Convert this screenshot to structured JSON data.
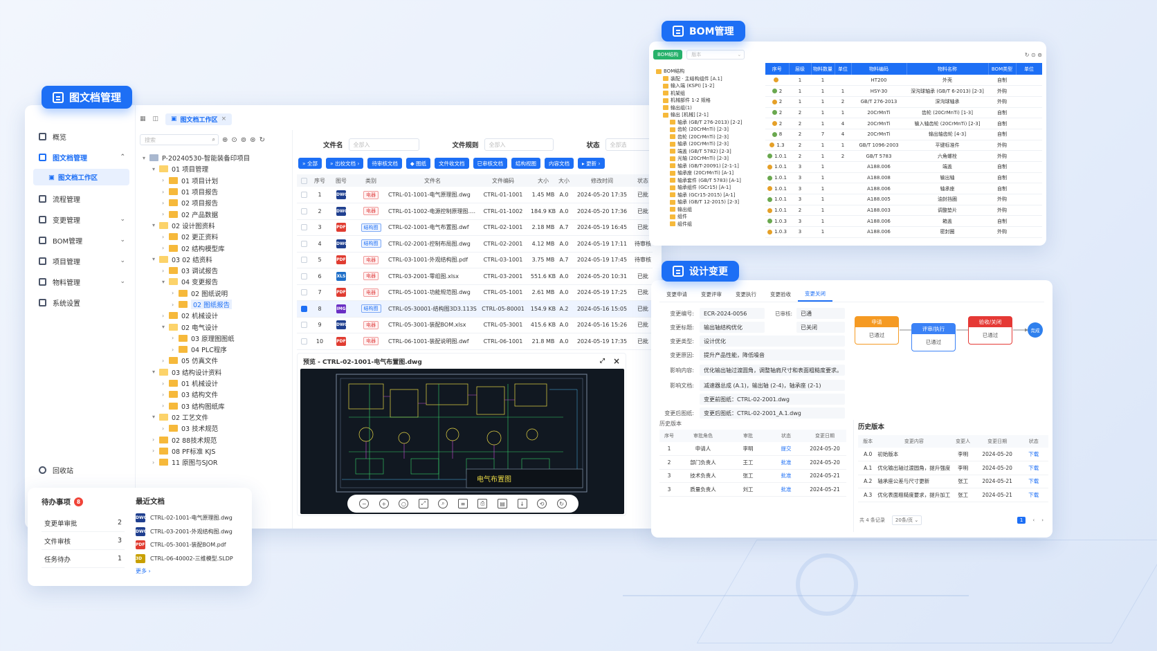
{
  "badges": {
    "doc": "图文档管理",
    "bom": "BOM管理",
    "change": "设计变更"
  },
  "sidebar": {
    "items": [
      {
        "label": "概览",
        "chev": ""
      },
      {
        "label": "图文档管理",
        "chev": "⌃",
        "active": true
      },
      {
        "label": "流程管理",
        "chev": ""
      },
      {
        "label": "变更管理",
        "chev": "⌄"
      },
      {
        "label": "BOM管理",
        "chev": "⌄"
      },
      {
        "label": "项目管理",
        "chev": "⌄"
      },
      {
        "label": "物料管理",
        "chev": "⌄"
      },
      {
        "label": "系统设置",
        "chev": ""
      }
    ],
    "sub": "图文档工作区",
    "recycle": "回收站"
  },
  "tab": {
    "label": "图文档工作区",
    "close": "×"
  },
  "tree": {
    "search_placeholder": "搜索",
    "nodes": [
      {
        "d": 0,
        "c": "▾",
        "t": "P-20240530-智能装备印项目",
        "f": "root"
      },
      {
        "d": 1,
        "c": "▾",
        "t": "01 项目管理",
        "f": "open"
      },
      {
        "d": 2,
        "c": "›",
        "t": "01 项目计划"
      },
      {
        "d": 2,
        "c": "›",
        "t": "01 项目报告"
      },
      {
        "d": 2,
        "c": "›",
        "t": "02 项目报告"
      },
      {
        "d": 2,
        "c": "›",
        "t": "02 产品数据"
      },
      {
        "d": 1,
        "c": "▾",
        "t": "02 设计图资料",
        "f": "open"
      },
      {
        "d": 2,
        "c": "›",
        "t": "02 更正资料"
      },
      {
        "d": 2,
        "c": "›",
        "t": "02 结构模型库"
      },
      {
        "d": 1,
        "c": "▾",
        "t": "03 02 结资料",
        "f": "open"
      },
      {
        "d": 2,
        "c": "›",
        "t": "03 调试报告"
      },
      {
        "d": 2,
        "c": "▾",
        "t": "04 变更报告",
        "f": "open"
      },
      {
        "d": 3,
        "c": "›",
        "t": "02 图纸说明"
      },
      {
        "d": 3,
        "c": "›",
        "t": "02 图纸报告",
        "sel": true
      },
      {
        "d": 2,
        "c": "›",
        "t": "02 机械设计"
      },
      {
        "d": 2,
        "c": "▾",
        "t": "02 电气设计",
        "f": "open"
      },
      {
        "d": 3,
        "c": "›",
        "t": "03 原理图图纸"
      },
      {
        "d": 3,
        "c": "›",
        "t": "04 PLC程序"
      },
      {
        "d": 2,
        "c": "›",
        "t": "05 仿真文件"
      },
      {
        "d": 1,
        "c": "▾",
        "t": "03 结构设计资料",
        "f": "open"
      },
      {
        "d": 2,
        "c": "›",
        "t": "01 机械设计"
      },
      {
        "d": 2,
        "c": "›",
        "t": "03 结构文件"
      },
      {
        "d": 2,
        "c": "›",
        "t": "03 结构图纸库"
      },
      {
        "d": 1,
        "c": "▾",
        "t": "02 工艺文件",
        "f": "open"
      },
      {
        "d": 2,
        "c": "›",
        "t": "03 技术规范"
      },
      {
        "d": 1,
        "c": "›",
        "t": "02 88技术规范"
      },
      {
        "d": 1,
        "c": "›",
        "t": "08 PF标准 KJS"
      },
      {
        "d": 1,
        "c": "›",
        "t": "11 原图与SJOR"
      }
    ]
  },
  "filters": {
    "file_name": "文件名",
    "file_name_ph": "全部入",
    "file_rule": "文件规则",
    "file_rule_ph": "全部入",
    "status": "状态",
    "status_ph": "全部选"
  },
  "toolbar": [
    "» 全部",
    "» 出校文档 ›",
    "待审核文档",
    "◆ 图纸",
    "文件收文档",
    "已审核文档",
    "结构视图",
    "内容文档",
    "▸ 更新 ›"
  ],
  "table": {
    "headers": [
      "",
      "序号",
      "图号",
      "类别",
      "文件名",
      "文件编码",
      "大小",
      "大小",
      "修改时间",
      "状态"
    ],
    "rows": [
      {
        "n": "1",
        "ic": "DWG",
        "icc": "#1f3f8f",
        "cat": "电器",
        "cb": false,
        "name": "CTRL-01-1001-电气原理图.dwg",
        "code": "CTRL-01-1001",
        "size": "1.45 MB",
        "v": "A.0",
        "time": "2024-05-20 17:35",
        "st": "已批"
      },
      {
        "n": "2",
        "ic": "DWG",
        "icc": "#1f3f8f",
        "cat": "电器",
        "cb": false,
        "name": "CTRL-01-1002-电源控制原理图.dwg",
        "code": "CTRL-01-1002",
        "size": "184.9 KB",
        "v": "A.0",
        "time": "2024-05-20 17:36",
        "st": "已批"
      },
      {
        "n": "3",
        "ic": "PDF",
        "icc": "#e03c31",
        "cat": "结构图",
        "cb": true,
        "name": "CTRL-02-1001-电气布置图.dwf",
        "code": "CTRL-02-1001",
        "size": "2.18 MB",
        "v": "A.7",
        "time": "2024-05-19 16:45",
        "st": "已批"
      },
      {
        "n": "4",
        "ic": "DWG",
        "icc": "#1f3f8f",
        "cat": "结构图",
        "cb": true,
        "name": "CTRL-02-2001-控制布局图.dwg",
        "code": "CTRL-02-2001",
        "size": "4.12 MB",
        "v": "A.0",
        "time": "2024-05-19 17:11",
        "st": "待审核"
      },
      {
        "n": "5",
        "ic": "PDF",
        "icc": "#e03c31",
        "cat": "电器",
        "cb": false,
        "name": "CTRL-03-1001-外观结构图.pdf",
        "code": "CTRL-03-1001",
        "size": "3.75 MB",
        "v": "A.7",
        "time": "2024-05-19 17:45",
        "st": "待审核"
      },
      {
        "n": "6",
        "ic": "XLS",
        "icc": "#1f6fc8",
        "cat": "电器",
        "cb": false,
        "name": "CTRL-03-2001-零组图.xlsx",
        "code": "CTRL-03-2001",
        "size": "551.6 KB",
        "v": "A.0",
        "time": "2024-05-20 10:31",
        "st": "已批"
      },
      {
        "n": "7",
        "ic": "PDF",
        "icc": "#e03c31",
        "cat": "电器",
        "cb": false,
        "name": "CTRL-05-1001-功能规范图.dwg",
        "code": "CTRL-05-1001",
        "size": "2.61 MB",
        "v": "A.0",
        "time": "2024-05-19 17:25",
        "st": "已批"
      },
      {
        "n": "8",
        "ic": "IMG",
        "icc": "#6a2fc4",
        "cat": "结构图",
        "cb": true,
        "name": "CTRL-05-30001-结构图3D3.113S",
        "code": "CTRL-05-80001",
        "size": "154.9 KB",
        "v": "A.2",
        "time": "2024-05-16 15:05",
        "st": "已批",
        "hl": true
      },
      {
        "n": "9",
        "ic": "DWG",
        "icc": "#1f3f8f",
        "cat": "电器",
        "cb": false,
        "name": "CTRL-05-3001-装配BOM.xlsx",
        "code": "CTRL-05-3001",
        "size": "415.6 KB",
        "v": "A.0",
        "time": "2024-05-16 15:26",
        "st": "已批"
      },
      {
        "n": "10",
        "ic": "PDF",
        "icc": "#e03c31",
        "cat": "电器",
        "cb": false,
        "name": "CTRL-06-1001-装配说明图.dwf",
        "code": "CTRL-06-1001",
        "size": "21.8 MB",
        "v": "A.0",
        "time": "2024-05-19 17:35",
        "st": "已批"
      }
    ]
  },
  "preview": {
    "title": "预览 - CTRL-02-1001-电气布置图.dwg",
    "drawing_title": "电气布置图"
  },
  "todo": {
    "title": "待办事项",
    "count": "8",
    "items": [
      {
        "label": "变更单审批",
        "n": "2"
      },
      {
        "label": "文件审核",
        "n": "3"
      },
      {
        "label": "任务待办",
        "n": "1"
      }
    ]
  },
  "recent": {
    "title": "最近文档",
    "more": "更多 ›",
    "items": [
      {
        "name": "CTRL-02-1001-电气原理图.dwg",
        "ic": "DWG",
        "c": "#1f3f8f"
      },
      {
        "name": "CTRL-03-2001-外观结构图.dwg",
        "ic": "DWG",
        "c": "#1f3f8f"
      },
      {
        "name": "CTRL-05-3001-装配BOM.pdf",
        "ic": "PDF",
        "c": "#e03c31"
      },
      {
        "name": "CTRL-06-40002-三维模型.SLDP",
        "ic": "3D",
        "c": "#c8a000"
      }
    ]
  },
  "bom": {
    "tab_active": "BOM结构",
    "select_ph": "版本",
    "tree": [
      "BOM结构",
      "装配 · 主结构组件 [A.1]",
      "输入端 (KSPI) [1-2]",
      "机架组",
      "机械部件 1-2 规格",
      "输出组(1)",
      "输出 [机械] [2-1]",
      "轴承 (GB/T 276-2013) [2-2]",
      "齿轮 (20CrMnTi) [2-3]",
      "齿轮 (20CrMnTi) [2-3]",
      "轴承 (20CrMnTi) [2-3]",
      "端盖 (GB/T 5782) [2-3]",
      "光轴 (20CrMnTi) [2-3]",
      "轴承 (GB/T-20091) [2-1-1]",
      "轴承座 (20CrMnTi) [A-1]",
      "轴承套件 (GB/T 5783) [A-1]",
      "轴承组件 (GCr15) [A-1]",
      "轴承 (GCr15-2015) [A-1]",
      "轴承 (GB/T 12-2015) [2-3]",
      "输出组",
      "组件",
      "组件组"
    ],
    "headers": [
      "序号",
      "层级",
      "物料数量",
      "单位",
      "物料编码",
      "物料名称",
      "BOM类型",
      "单位"
    ],
    "rows": [
      [
        "",
        "1",
        "1",
        "",
        "HT200",
        "外壳",
        "自制"
      ],
      [
        "2",
        "1",
        "1",
        "1",
        "HSY-30",
        "深沟球轴承 (GB/T 6-2013) [2-3]",
        "外购"
      ],
      [
        "2",
        "1",
        "1",
        "2",
        "GB/T 276-2013",
        "深沟球轴承",
        "外购"
      ],
      [
        "2",
        "2",
        "1",
        "1",
        "20CrMnTi",
        "齿轮 (20CrMnTi) [1-3]",
        "自制"
      ],
      [
        "2",
        "2",
        "1",
        "4",
        "20CrMnTi",
        "输入轴齿轮 (20CrMnTi) [2-3]",
        "自制"
      ],
      [
        "8",
        "2",
        "7",
        "4",
        "20CrMnTi",
        "输出轴齿轮 [4-3]",
        "自制"
      ],
      [
        "1.3",
        "2",
        "1",
        "1",
        "GB/T 1096-2003",
        "平键标准件",
        "外购"
      ],
      [
        "1.0.1",
        "2",
        "1",
        "2",
        "GB/T 5783",
        "六角螺栓",
        "外购"
      ],
      [
        "1.0.1",
        "3",
        "1",
        "",
        "A188.006",
        "端盖",
        "自制"
      ],
      [
        "1.0.1",
        "3",
        "1",
        "",
        "A188.008",
        "输出轴",
        "自制"
      ],
      [
        "1.0.1",
        "3",
        "1",
        "",
        "A188.006",
        "轴承座",
        "自制"
      ],
      [
        "1.0.1",
        "3",
        "1",
        "",
        "A188.005",
        "油封挡圈",
        "外购"
      ],
      [
        "1.0.1",
        "2",
        "1",
        "",
        "A188.003",
        "调整垫片",
        "外购"
      ],
      [
        "1.0.3",
        "3",
        "1",
        "",
        "A188.006",
        "箱盖",
        "自制"
      ],
      [
        "1.0.3",
        "3",
        "1",
        "",
        "A188.006",
        "密封圈",
        "外购"
      ]
    ]
  },
  "change": {
    "tabs": [
      "变更申请",
      "变更评审",
      "变更执行",
      "变更验收",
      "变更关闭"
    ],
    "fields": [
      {
        "l": "变更编号:",
        "v": "ECR-2024-0056",
        "l2": "已审核:",
        "v2": "已通"
      },
      {
        "l": "变更标题:",
        "v": "输出轴结构优化",
        "l2": "",
        "v2": "已关闭"
      },
      {
        "l": "变更类型:",
        "v": "设计优化"
      },
      {
        "l": "变更原因:",
        "v": "提升产品性能，降低噪音"
      },
      {
        "l": "影响内容:",
        "v": "优化输出轴过渡圆角，调整轴肩尺寸和表面粗糙度要求。"
      },
      {
        "l": "影响文档:",
        "v": "减速器总成 (A.1)，输出轴 (2-4)，轴承座 (2-1)"
      },
      {
        "l": "",
        "v": "变更前图纸：CTRL-02-2001.dwg"
      },
      {
        "l": "变更后图纸:",
        "v": "变更后图纸：CTRL-02-2001_A.1.dwg"
      }
    ],
    "flow": [
      {
        "h": "申请",
        "b": "已通过",
        "c": "#f59a23"
      },
      {
        "h": "评审/执行",
        "b": "已通过",
        "c": "#3b82f6"
      },
      {
        "h": "验收/关闭",
        "b": "已通过",
        "c": "#e53935"
      }
    ],
    "flow_end": "完成",
    "approve_title": "历史版本",
    "approve_headers": [
      "序号",
      "审批角色",
      "审批",
      "状态",
      "变更日期"
    ],
    "approve_rows": [
      [
        "1",
        "申请人",
        "李明",
        "提交",
        "2024-05-20"
      ],
      [
        "2",
        "部门负责人",
        "王工",
        "批准",
        "2024-05-20"
      ],
      [
        "3",
        "技术负责人",
        "张工",
        "批准",
        "2024-05-21"
      ],
      [
        "3",
        "质量负责人",
        "刘工",
        "批准",
        "2024-05-21"
      ]
    ],
    "history_title": "历史版本",
    "history_headers": [
      "版本",
      "变更内容",
      "变更人",
      "变更日期",
      "状态"
    ],
    "history_rows": [
      [
        "A.0",
        "初始版本",
        "李明",
        "2024-05-20",
        "下载"
      ],
      [
        "A.1",
        "优化输出轴过渡圆角，提升强度",
        "李明",
        "2024-05-20",
        "下载"
      ],
      [
        "A.2",
        "轴承座公差与尺寸更新",
        "张工",
        "2024-05-21",
        "下载"
      ],
      [
        "A.3",
        "优化表面粗糙度要求，提升加工工艺",
        "张工",
        "2024-05-21",
        "下载"
      ]
    ],
    "pager_total": "共 4 条记录",
    "pager_size": "20条/页",
    "pager_page": "1"
  }
}
